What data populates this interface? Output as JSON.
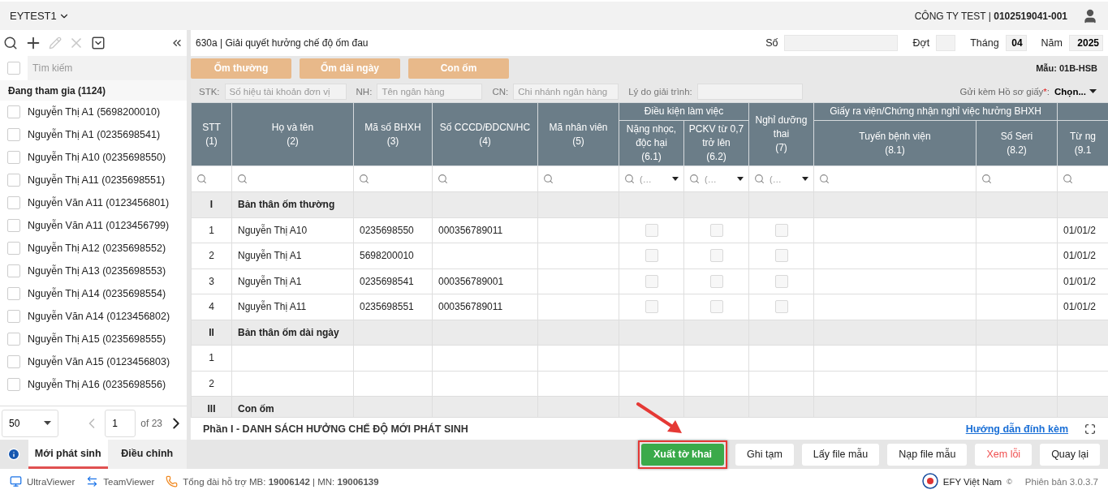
{
  "top_bar": {
    "workspace": "EYTEST1",
    "company": "CÔNG TY TEST | **0102519041-001**"
  },
  "sidebar": {
    "toolbar": [
      {
        "kind": "search",
        "disabled": false
      },
      {
        "kind": "add",
        "disabled": false
      },
      {
        "kind": "edit",
        "disabled": true
      },
      {
        "kind": "delete",
        "disabled": true
      },
      {
        "kind": "dropdown",
        "disabled": false
      }
    ],
    "search": {
      "placeholder": "Tìm kiếm",
      "checked": false
    },
    "group": "Đang tham gia (1124)",
    "items": [
      {
        "label": "Nguyễn Thị A1 (5698200010)",
        "checked": false
      },
      {
        "label": "Nguyễn Thị A1 (0235698541)",
        "checked": false
      },
      {
        "label": "Nguyễn Thị A10 (0235698550)",
        "checked": false
      },
      {
        "label": "Nguyễn Thị A11 (0235698551)",
        "checked": false
      },
      {
        "label": "Nguyễn Văn A11 (0123456801)",
        "checked": false
      },
      {
        "label": "Nguyễn Văn A11 (0123456799)",
        "checked": false
      },
      {
        "label": "Nguyễn Thị A12 (0235698552)",
        "checked": false
      },
      {
        "label": "Nguyễn Thị A13 (0235698553)",
        "checked": false
      },
      {
        "label": "Nguyễn Thị A14 (0235698554)",
        "checked": false
      },
      {
        "label": "Nguyễn Văn A14 (0123456802)",
        "checked": false
      },
      {
        "label": "Nguyễn Thị A15 (0235698555)",
        "checked": false
      },
      {
        "label": "Nguyễn Văn A15 (0123456803)",
        "checked": false
      },
      {
        "label": "Nguyễn Thị A16 (0235698556)",
        "checked": false
      }
    ],
    "pagination": {
      "page_size": "50",
      "page": "1",
      "total": "of 23",
      "prev_disabled": true
    },
    "tabs": [
      {
        "label": "Mới phát sinh",
        "selected": true
      },
      {
        "label": "Điều chỉnh",
        "selected": false
      }
    ]
  },
  "form": {
    "title": "630a | Giải quyết hưởng chế độ ốm đau",
    "fields": [
      {
        "label": "Số"
      },
      {
        "label": "Đợt"
      },
      {
        "label": "Tháng",
        "value": "04"
      },
      {
        "label": "Năm",
        "value": "2025"
      }
    ],
    "categories": [
      {
        "label": "Ốm thường"
      },
      {
        "label": "Ốm dài ngày"
      },
      {
        "label": "Con ốm"
      }
    ],
    "template": "Mẫu: 01B-HSB",
    "bank_fields": [
      {
        "label": "STK:",
        "placeholder": "Số hiệu tài khoản đơn vị"
      },
      {
        "label": "NH:",
        "placeholder": "Tên ngân hàng"
      },
      {
        "label": "CN:",
        "placeholder": "Chi nhánh ngân hàng"
      },
      {
        "label": "Lý do giải trình:"
      }
    ],
    "paper_docs": {
      "label": "Gửi kèm Hồ sơ giấy",
      "required": "*",
      "separator": ":",
      "value": "Chọn..."
    }
  },
  "table": {
    "columns": [
      {
        "label": "STT",
        "number": "(1)",
        "filter": {
          "kind": "search"
        }
      },
      {
        "label": "Họ và tên",
        "number": "(2)",
        "filter": {
          "kind": "search"
        }
      },
      {
        "label": "Mã số BHXH",
        "number": "(3)",
        "filter": {
          "kind": "search"
        }
      },
      {
        "label": "Số CCCD/ĐDCN/HC",
        "number": "(4)",
        "filter": {
          "kind": "search"
        }
      },
      {
        "label": "Mã nhân viên",
        "number": "(5)",
        "filter": {
          "kind": "search"
        }
      },
      {
        "label": "Điều kiện làm việc",
        "children": [
          {
            "label": "Nặng nhọc, độc hại",
            "number": "(6.1)",
            "filter": {
              "kind": "select",
              "placeholder": "(…"
            }
          },
          {
            "label": "PCKV từ 0,7 trở lên",
            "number": "(6.2)",
            "filter": {
              "kind": "select",
              "placeholder": "(…"
            }
          }
        ]
      },
      {
        "label": "Nghỉ dưỡng thai",
        "number": "(7)",
        "filter": {
          "kind": "select",
          "placeholder": "(…"
        }
      },
      {
        "label": "Giấy ra viện/Chứng nhận nghỉ việc hưởng BHXH",
        "children": [
          {
            "label": "Tuyến bệnh viện",
            "number": "(8.1)",
            "filter": {
              "kind": "search"
            }
          },
          {
            "label": "Số Seri",
            "number": "(8.2)",
            "filter": {
              "kind": "search"
            }
          }
        ]
      },
      {
        "children": [
          {
            "label": "Từ ng",
            "number": "(9.1",
            "filter": {
              "kind": "search"
            }
          }
        ]
      }
    ],
    "rows": [
      {
        "kind": "section",
        "stt": "I",
        "title": "Bản thân ốm thường"
      },
      {
        "kind": "data",
        "stt": "1",
        "name": "Nguyễn Thị A10",
        "bhxh": "0235698550",
        "cccd": "000356789011",
        "checks": [
          {
            "checked": false
          },
          {
            "checked": false
          },
          {
            "checked": false
          }
        ],
        "date": "01/01/2"
      },
      {
        "kind": "data",
        "stt": "2",
        "name": "Nguyễn Thị A1",
        "bhxh": "5698200010",
        "checks": [
          {
            "checked": false
          },
          {
            "checked": false
          },
          {
            "checked": false
          }
        ],
        "date": "01/01/2"
      },
      {
        "kind": "data",
        "stt": "3",
        "name": "Nguyễn Thị A1",
        "bhxh": "0235698541",
        "cccd": "000356789001",
        "checks": [
          {
            "checked": false
          },
          {
            "checked": false
          },
          {
            "checked": false
          }
        ],
        "date": "01/01/2"
      },
      {
        "kind": "data",
        "stt": "4",
        "name": "Nguyễn Thị A11",
        "bhxh": "0235698551",
        "cccd": "000356789011",
        "checks": [
          {
            "checked": false
          },
          {
            "checked": false
          },
          {
            "checked": false
          }
        ],
        "date": "01/01/2"
      },
      {
        "kind": "section",
        "stt": "II",
        "title": "Bản thân ốm dài ngày"
      },
      {
        "kind": "data",
        "stt": "1"
      },
      {
        "kind": "data",
        "stt": "2"
      },
      {
        "kind": "section",
        "stt": "III",
        "title": "Con ốm"
      }
    ]
  },
  "section_footer": {
    "title": "Phần I - DANH SÁCH HƯỞNG CHẾ ĐỘ MỚI PHÁT SINH",
    "link": "Hướng dẫn đính kèm"
  },
  "actions": [
    {
      "label": "Xuất tờ khai",
      "kind": "primary",
      "highlighted": true
    },
    {
      "label": "Ghi tạm",
      "kind": "default",
      "highlighted": false
    },
    {
      "label": "Lấy file mẫu",
      "kind": "default",
      "highlighted": false
    },
    {
      "label": "Nạp file mẫu",
      "kind": "default",
      "highlighted": false
    },
    {
      "label": "Xem lỗi",
      "kind": "danger",
      "highlighted": false
    },
    {
      "label": "Quay lại",
      "kind": "default",
      "highlighted": false
    }
  ],
  "status_bar": {
    "tools": [
      {
        "kind": "monitor",
        "label": "UltraViewer"
      },
      {
        "kind": "remote",
        "label": "TeamViewer"
      },
      {
        "kind": "phone",
        "label": "Tổng đài hỗ trợ MB: **19006142** | MN: **19006139**"
      }
    ],
    "brand": "EFY Việt Nam",
    "copyright": "©",
    "version": "Phiên bản 3.0.3.7"
  }
}
